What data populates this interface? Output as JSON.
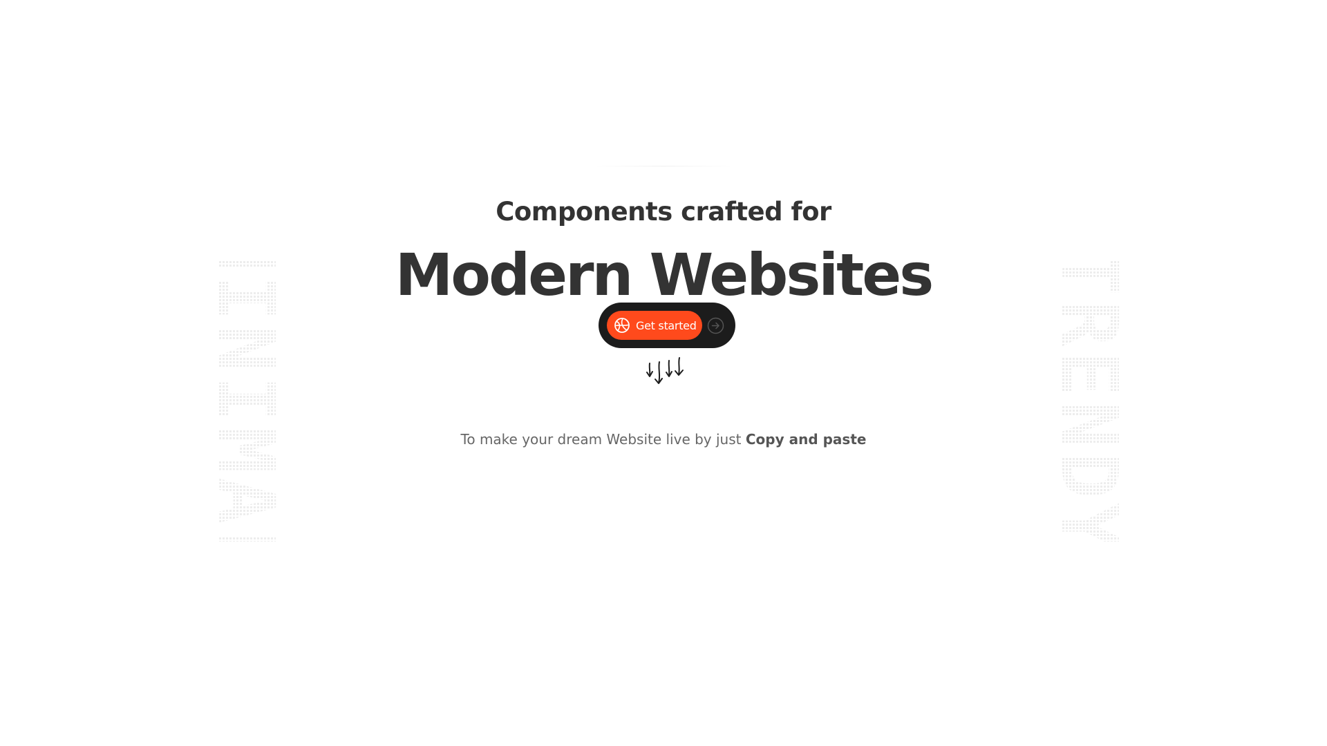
{
  "hero": {
    "eyebrow": "Components crafted for",
    "headline": "Modern Websites",
    "cta": {
      "label": "Get started",
      "icon": "globe-icon",
      "secondary_icon": "arrow-right-circle-icon",
      "button_color": "#ff4a1c",
      "pill_color": "#1c1c1c"
    },
    "doodle_icon": "hand-drawn-down-arrows-icon",
    "subline": {
      "text": "To make your dream Website live by just ",
      "emphasis": "Copy and paste"
    }
  },
  "decor": {
    "left_word": "MINIMAL",
    "right_word": "TRENDY"
  },
  "colors": {
    "background": "#ffffff",
    "text": "#333333",
    "muted_text": "#666666",
    "accent": "#ff4a1c"
  }
}
